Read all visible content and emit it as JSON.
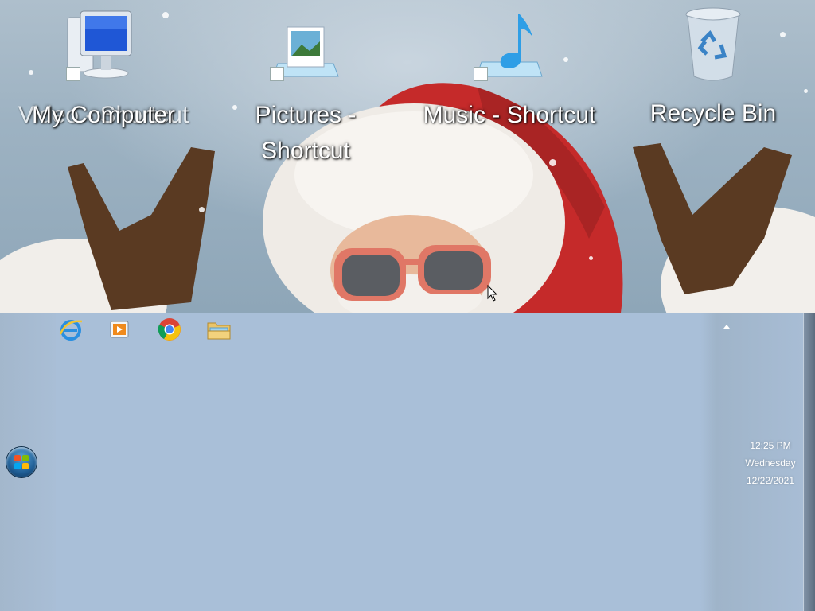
{
  "desktop": {
    "icons": [
      {
        "label": "My Computer",
        "overlap_label": "Video - Shortcut",
        "icon": "computer-icon"
      },
      {
        "label": "Pictures - Shortcut",
        "icon": "pictures-icon"
      },
      {
        "label": "Music - Shortcut",
        "icon": "music-icon"
      },
      {
        "label": "Recycle Bin",
        "icon": "recycle-bin-icon"
      }
    ]
  },
  "taskbar": {
    "pinned": [
      {
        "icon": "internet-explorer-icon"
      },
      {
        "icon": "media-player-icon"
      },
      {
        "icon": "chrome-icon"
      },
      {
        "icon": "file-explorer-icon"
      }
    ],
    "clock": {
      "time": "12:25 PM",
      "day": "Wednesday",
      "date": "12/22/2021"
    }
  },
  "colors": {
    "taskbar": "#a9bfd8",
    "santa_red": "#c52a2a",
    "glove_brown": "#5a3a22"
  }
}
